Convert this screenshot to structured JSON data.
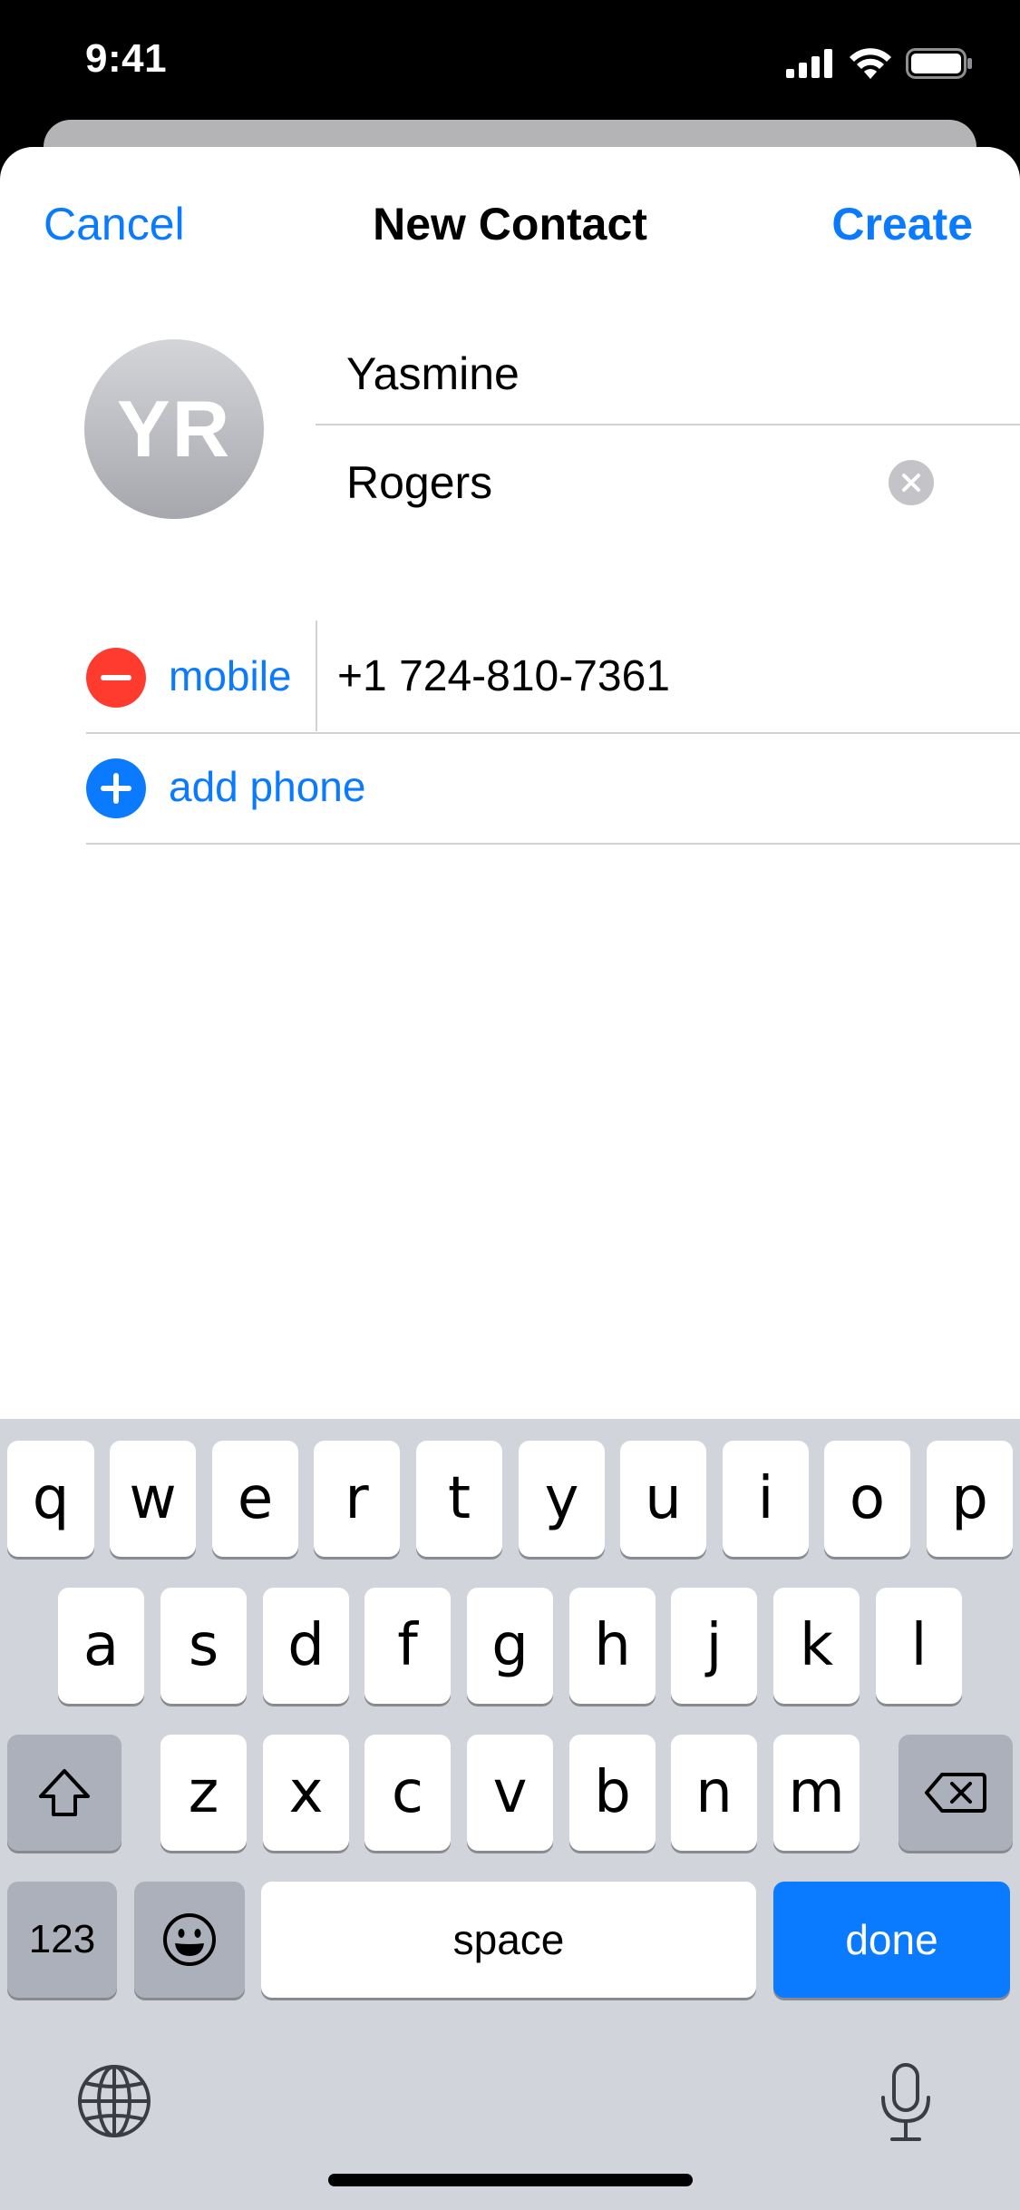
{
  "status_bar": {
    "time": "9:41"
  },
  "nav": {
    "cancel": "Cancel",
    "title": "New Contact",
    "create": "Create"
  },
  "contact": {
    "initials": "YR",
    "first_name": "Yasmine",
    "last_name": "Rogers",
    "phone_label": "mobile",
    "phone": "+1 724-810-7361",
    "add_phone": "add phone"
  },
  "keyboard": {
    "row1": [
      "q",
      "w",
      "e",
      "r",
      "t",
      "y",
      "u",
      "i",
      "o",
      "p"
    ],
    "row2": [
      "a",
      "s",
      "d",
      "f",
      "g",
      "h",
      "j",
      "k",
      "l"
    ],
    "row3": [
      "z",
      "x",
      "c",
      "v",
      "b",
      "n",
      "m"
    ],
    "numbers": "123",
    "space": "space",
    "done": "done"
  },
  "colors": {
    "accent": "#0a7aff",
    "destructive": "#ff3b30",
    "keyboard_bg": "#d1d4db"
  }
}
